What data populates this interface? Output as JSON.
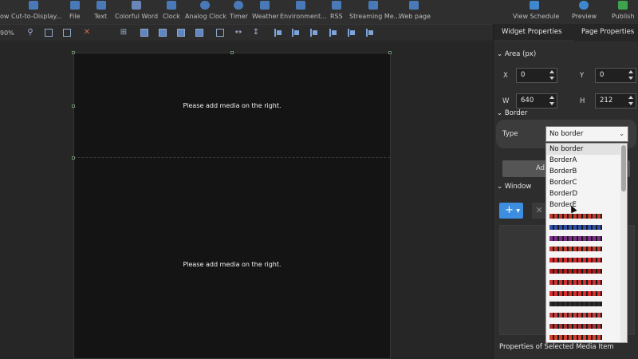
{
  "toolbar": {
    "items": [
      {
        "label": "ow Cut-to-Display..."
      },
      {
        "label": "File"
      },
      {
        "label": "Text"
      },
      {
        "label": "Colorful Word"
      },
      {
        "label": "Clock"
      },
      {
        "label": "Analog Clock"
      },
      {
        "label": "Timer"
      },
      {
        "label": "Weather"
      },
      {
        "label": "Environment..."
      },
      {
        "label": "RSS"
      },
      {
        "label": "Streaming Me..."
      },
      {
        "label": "Web page"
      }
    ],
    "right": [
      {
        "label": "View Schedule"
      },
      {
        "label": "Preview"
      },
      {
        "label": "Publish"
      }
    ]
  },
  "toolbar2": {
    "zoom": "90%"
  },
  "canvas": {
    "zone1_text": "Please add media on the right.",
    "zone2_text": "Please add media on the right."
  },
  "panel": {
    "tabs": {
      "widget": "Widget Properties",
      "page": "Page Properties"
    },
    "area": {
      "title": "Area (px)",
      "x_label": "X",
      "x_value": "0",
      "y_label": "Y",
      "y_value": "0",
      "w_label": "W",
      "w_value": "640",
      "h_label": "H",
      "h_value": "212"
    },
    "border": {
      "title": "Border",
      "type_label": "Type",
      "type_value": "No border",
      "add_label": "Ad"
    },
    "window": {
      "title": "Window"
    },
    "selected_props": "Properties of Selected Media Item"
  },
  "dropdown": {
    "options": [
      "No border",
      "BorderA",
      "BorderB",
      "BorderC",
      "BorderD",
      "BorderE"
    ],
    "swatch_colors": [
      "#c0392b",
      "#2e4fa8",
      "#7a2e8a",
      "#c0392b",
      "#d8282a",
      "#b01c1c",
      "#d03030",
      "#e02a2a",
      "#2a2a2a",
      "#c63a3a",
      "#a83232",
      "#d6402c"
    ]
  }
}
